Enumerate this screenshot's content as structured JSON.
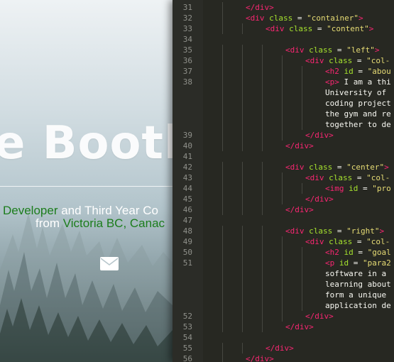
{
  "hero": {
    "name": "e Booth",
    "tagline_part1_green": "Developer",
    "tagline_part1_rest": " and Third Year Co",
    "tagline_part2_pre": "from ",
    "tagline_part2_green": "Victoria BC, Canac",
    "mail_icon": "envelope-icon"
  },
  "editor": {
    "lines": [
      {
        "n": "31",
        "indent": 2,
        "tokens": [
          [
            "t-tag",
            "</"
          ],
          [
            "t-tag",
            "div"
          ],
          [
            "t-tag",
            ">"
          ]
        ]
      },
      {
        "n": "32",
        "indent": 2,
        "tokens": [
          [
            "t-tag",
            "<div"
          ],
          [
            "t-attr",
            " class"
          ],
          [
            "t-pl",
            " = "
          ],
          [
            "t-str",
            "\"container\""
          ],
          [
            "t-tag",
            ">"
          ]
        ]
      },
      {
        "n": "33",
        "indent": 3,
        "tokens": [
          [
            "t-tag",
            "<div"
          ],
          [
            "t-attr",
            " class"
          ],
          [
            "t-pl",
            " = "
          ],
          [
            "t-str",
            "\"content\""
          ],
          [
            "t-tag",
            ">"
          ]
        ]
      },
      {
        "n": "34",
        "indent": 0,
        "tokens": []
      },
      {
        "n": "35",
        "indent": 4,
        "tokens": [
          [
            "t-tag",
            "<div"
          ],
          [
            "t-attr",
            " class"
          ],
          [
            "t-pl",
            " = "
          ],
          [
            "t-str",
            "\"left\""
          ],
          [
            "t-tag",
            ">"
          ]
        ]
      },
      {
        "n": "36",
        "indent": 5,
        "tokens": [
          [
            "t-tag",
            "<div"
          ],
          [
            "t-attr",
            " class"
          ],
          [
            "t-pl",
            " = "
          ],
          [
            "t-str",
            "\"col-"
          ]
        ]
      },
      {
        "n": "37",
        "indent": 6,
        "tokens": [
          [
            "t-tag",
            "<h2"
          ],
          [
            "t-attr",
            " id"
          ],
          [
            "t-pl",
            " = "
          ],
          [
            "t-str",
            "\"abou"
          ]
        ]
      },
      {
        "n": "38",
        "indent": 6,
        "tokens": [
          [
            "t-tag",
            "<p"
          ],
          [
            "t-tag",
            ">"
          ],
          [
            "t-pl",
            " I am a thi"
          ]
        ]
      },
      {
        "n": "",
        "indent": 6,
        "tokens": [
          [
            "t-pl",
            "University of"
          ]
        ]
      },
      {
        "n": "",
        "indent": 6,
        "tokens": [
          [
            "t-pl",
            "coding project"
          ]
        ]
      },
      {
        "n": "",
        "indent": 6,
        "tokens": [
          [
            "t-pl",
            "the gym and re"
          ]
        ]
      },
      {
        "n": "",
        "indent": 6,
        "tokens": [
          [
            "t-pl",
            "together to de"
          ]
        ]
      },
      {
        "n": "39",
        "indent": 5,
        "tokens": [
          [
            "t-tag",
            "</div>"
          ]
        ]
      },
      {
        "n": "40",
        "indent": 4,
        "tokens": [
          [
            "t-tag",
            "</div>"
          ]
        ]
      },
      {
        "n": "41",
        "indent": 0,
        "tokens": []
      },
      {
        "n": "42",
        "indent": 4,
        "tokens": [
          [
            "t-tag",
            "<div"
          ],
          [
            "t-attr",
            " class"
          ],
          [
            "t-pl",
            " = "
          ],
          [
            "t-str",
            "\"center\""
          ],
          [
            "t-tag",
            ">"
          ]
        ]
      },
      {
        "n": "43",
        "indent": 5,
        "tokens": [
          [
            "t-tag",
            "<div"
          ],
          [
            "t-attr",
            " class"
          ],
          [
            "t-pl",
            " = "
          ],
          [
            "t-str",
            "\"col-"
          ]
        ]
      },
      {
        "n": "44",
        "indent": 6,
        "tokens": [
          [
            "t-tag",
            "<img"
          ],
          [
            "t-attr",
            " id"
          ],
          [
            "t-pl",
            " = "
          ],
          [
            "t-str",
            "\"pro"
          ]
        ]
      },
      {
        "n": "45",
        "indent": 5,
        "tokens": [
          [
            "t-tag",
            "</div>"
          ]
        ]
      },
      {
        "n": "46",
        "indent": 4,
        "tokens": [
          [
            "t-tag",
            "</div>"
          ]
        ]
      },
      {
        "n": "47",
        "indent": 0,
        "tokens": []
      },
      {
        "n": "48",
        "indent": 4,
        "tokens": [
          [
            "t-tag",
            "<div"
          ],
          [
            "t-attr",
            " class"
          ],
          [
            "t-pl",
            " = "
          ],
          [
            "t-str",
            "\"right\""
          ],
          [
            "t-tag",
            ">"
          ]
        ]
      },
      {
        "n": "49",
        "indent": 5,
        "tokens": [
          [
            "t-tag",
            "<div"
          ],
          [
            "t-attr",
            " class"
          ],
          [
            "t-pl",
            " = "
          ],
          [
            "t-str",
            "\"col-"
          ]
        ]
      },
      {
        "n": "50",
        "indent": 6,
        "tokens": [
          [
            "t-tag",
            "<h2"
          ],
          [
            "t-attr",
            " id"
          ],
          [
            "t-pl",
            " = "
          ],
          [
            "t-str",
            "\"goal"
          ]
        ]
      },
      {
        "n": "51",
        "indent": 6,
        "tokens": [
          [
            "t-tag",
            "<p"
          ],
          [
            "t-attr",
            " id"
          ],
          [
            "t-pl",
            " = "
          ],
          [
            "t-str",
            "\"para2"
          ]
        ]
      },
      {
        "n": "",
        "indent": 6,
        "tokens": [
          [
            "t-pl",
            "software in a"
          ]
        ]
      },
      {
        "n": "",
        "indent": 6,
        "tokens": [
          [
            "t-pl",
            "learning about"
          ]
        ]
      },
      {
        "n": "",
        "indent": 6,
        "tokens": [
          [
            "t-pl",
            "form a unique"
          ]
        ]
      },
      {
        "n": "",
        "indent": 6,
        "tokens": [
          [
            "t-pl",
            "application de"
          ]
        ]
      },
      {
        "n": "52",
        "indent": 5,
        "tokens": [
          [
            "t-tag",
            "</div>"
          ]
        ]
      },
      {
        "n": "53",
        "indent": 4,
        "tokens": [
          [
            "t-tag",
            "</div>"
          ]
        ]
      },
      {
        "n": "54",
        "indent": 0,
        "tokens": []
      },
      {
        "n": "55",
        "indent": 3,
        "tokens": [
          [
            "t-tag",
            "</div>"
          ]
        ]
      },
      {
        "n": "56",
        "indent": 2,
        "tokens": [
          [
            "t-tag",
            "</div>"
          ]
        ]
      }
    ]
  },
  "colors": {
    "editor_bg": "#272822",
    "tag": "#f92672",
    "attribute": "#a6e22e",
    "string": "#e6db74",
    "plain": "#f8f8f2",
    "tagline_green": "#1c7d1c"
  }
}
